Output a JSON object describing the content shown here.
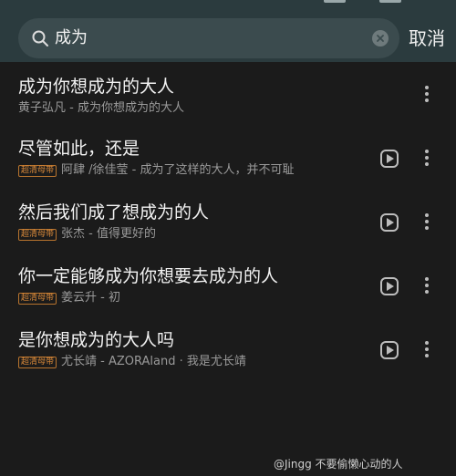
{
  "search": {
    "query": "成为",
    "cancel_label": "取消"
  },
  "results": [
    {
      "title": "成为你想成为的大人",
      "badge": "",
      "subtitle": "黄子弘凡 - 成为你想成为的大人",
      "has_play": false
    },
    {
      "title": "尽管如此，还是",
      "badge": "超清母带",
      "subtitle": "阿肆 /徐佳莹 - 成为了这样的大人，并不可耻",
      "has_play": true
    },
    {
      "title": "然后我们成了想成为的人",
      "badge": "超清母带",
      "subtitle": "张杰 - 值得更好的",
      "has_play": true
    },
    {
      "title": "你一定能够成为你想要去成为的人",
      "badge": "超清母带",
      "subtitle": "姜云升 - 初",
      "has_play": true
    },
    {
      "title": "是你想成为的大人吗",
      "badge": "超清母带",
      "subtitle": "尤长靖 - AZORAland · 我是尤长靖",
      "has_play": true
    }
  ],
  "watermark": "@Jingg 不要偷懒心动的人",
  "icons": [
    "search-icon",
    "clear-icon",
    "play-icon",
    "more-icon"
  ],
  "colors": {
    "header_bg": "#2b3b3e",
    "page_bg": "#1b1b1b",
    "badge": "#d8893a"
  }
}
